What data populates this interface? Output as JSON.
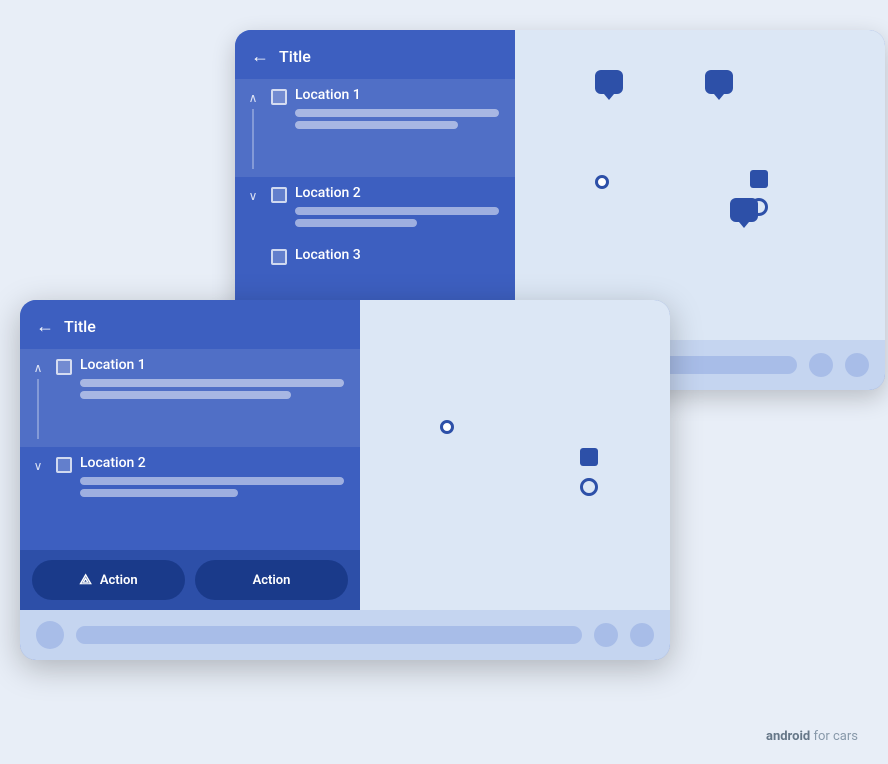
{
  "back_card": {
    "title": "Title",
    "locations": [
      {
        "name": "Location 1",
        "expanded": true,
        "detail_bars": [
          "full",
          "medium"
        ]
      },
      {
        "name": "Location 2",
        "expanded": false,
        "detail_bars": [
          "full",
          "shorter"
        ]
      },
      {
        "name": "Location 3",
        "expanded": false,
        "detail_bars": []
      }
    ]
  },
  "front_card": {
    "title": "Title",
    "locations": [
      {
        "name": "Location 1",
        "expanded": true,
        "detail_bars": [
          "full",
          "medium"
        ]
      },
      {
        "name": "Location 2",
        "expanded": false,
        "detail_bars": [
          "full",
          "shorter"
        ]
      }
    ],
    "actions": [
      {
        "label": "Action",
        "has_icon": true
      },
      {
        "label": "Action",
        "has_icon": false
      }
    ]
  },
  "brand": {
    "prefix": "android",
    "suffix": " for cars"
  },
  "icons": {
    "back_arrow": "←",
    "chevron_up": "∧",
    "chevron_down": "∨",
    "action_icon": "⟁"
  }
}
